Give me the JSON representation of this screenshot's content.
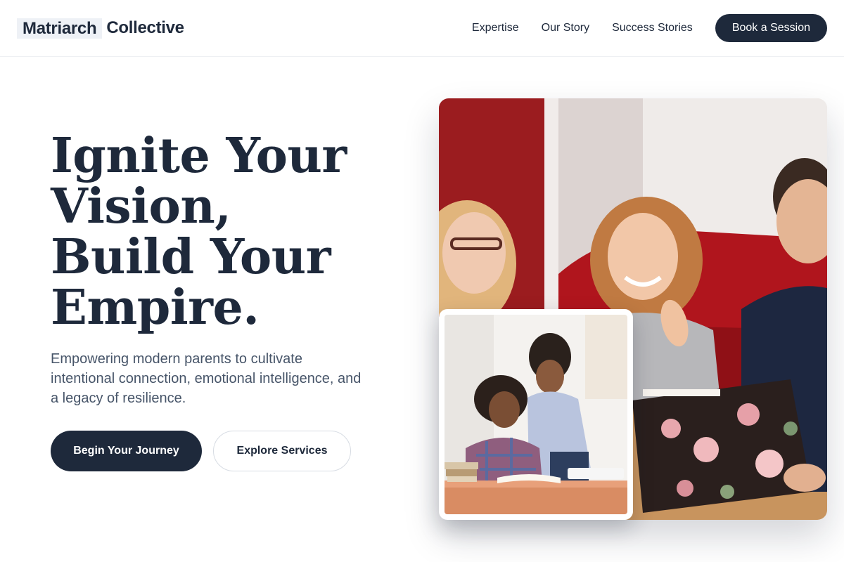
{
  "header": {
    "logo_part1": "Matriarch",
    "logo_part2": "Collective",
    "nav": [
      {
        "label": "Expertise"
      },
      {
        "label": "Our Story"
      },
      {
        "label": "Success Stories"
      }
    ],
    "cta_label": "Book a Session"
  },
  "hero": {
    "headline_lines": [
      "Ignite Your",
      "Vision,",
      "Build Your",
      "Empire."
    ],
    "subtext": "Empowering modern parents to cultivate intentional connection, emotional intelligence, and a legacy of resilience.",
    "primary_button": "Begin Your Journey",
    "secondary_button": "Explore Services"
  },
  "colors": {
    "primary": "#1e293b",
    "muted_text": "#475569",
    "border": "#d7dce3"
  }
}
